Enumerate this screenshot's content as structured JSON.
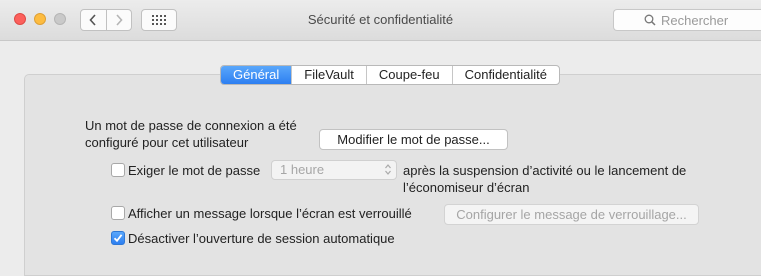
{
  "window": {
    "title": "Sécurité et confidentialité"
  },
  "search": {
    "placeholder": "Rechercher"
  },
  "tabs": [
    {
      "label": "Général",
      "active": true
    },
    {
      "label": "FileVault",
      "active": false
    },
    {
      "label": "Coupe-feu",
      "active": false
    },
    {
      "label": "Confidentialité",
      "active": false
    }
  ],
  "general": {
    "password_text": "Un mot de passe de connexion a été configuré pour cet utilisateur",
    "modify_button": "Modifier le mot de passe...",
    "require_password": {
      "label": "Exiger le mot de passe",
      "checked": false,
      "delay_selected": "1 heure",
      "after_text": "après la suspension d’activité ou le lancement de l’économiseur d’écran"
    },
    "show_message": {
      "label": "Afficher un message lorsque l’écran est verrouillé",
      "checked": false,
      "configure_button": "Configurer le message de verrouillage..."
    },
    "disable_autologin": {
      "label": "Désactiver l’ouverture de session automatique",
      "checked": true
    }
  },
  "colors": {
    "accent": "#2d7ff1",
    "close": "#fc605c",
    "minimize": "#fdbc40",
    "zoom_disabled": "#c9c9c9"
  },
  "icons": [
    "close-icon",
    "minimize-icon",
    "zoom-icon",
    "chevron-left-icon",
    "chevron-right-icon",
    "grid-icon",
    "search-icon",
    "checkmark-icon",
    "updown-chevron-icon"
  ]
}
